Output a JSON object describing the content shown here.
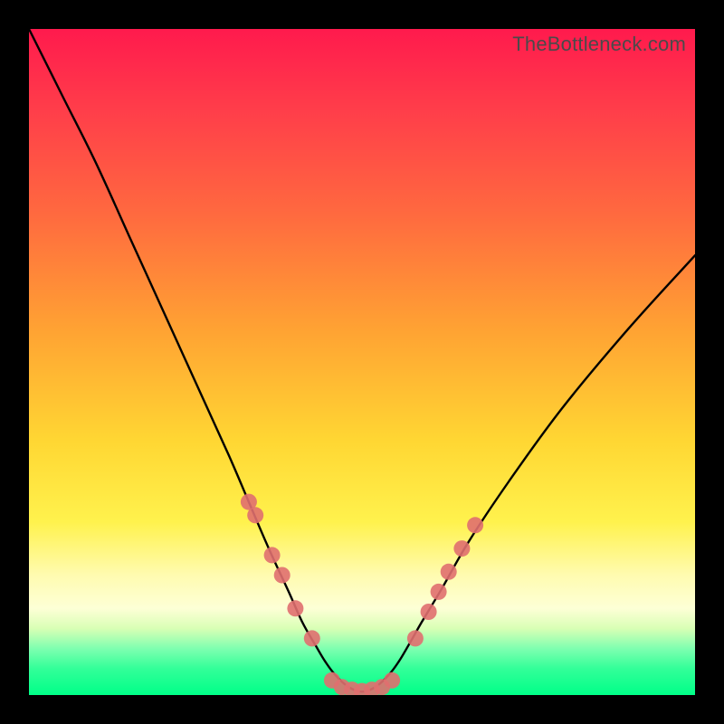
{
  "watermark": "TheBottleneck.com",
  "colors": {
    "frame": "#000000",
    "gradient_top": "#ff1a4d",
    "gradient_mid": "#ffd733",
    "gradient_bottom": "#00ff88",
    "curve": "#000000",
    "dots": "#e06f6f"
  },
  "chart_data": {
    "type": "line",
    "title": "",
    "xlabel": "",
    "ylabel": "",
    "xlim": [
      0,
      100
    ],
    "ylim": [
      0,
      100
    ],
    "grid": false,
    "series": [
      {
        "name": "bottleneck-curve",
        "x": [
          0,
          5,
          10,
          15,
          20,
          25,
          30,
          33,
          36,
          39,
          41,
          43,
          44.5,
          46,
          48,
          50,
          52,
          54,
          55.5,
          57,
          59,
          62,
          66,
          72,
          80,
          90,
          100
        ],
        "y": [
          100,
          90,
          80,
          69,
          58,
          47,
          36,
          29,
          22,
          15.5,
          11,
          7.5,
          5,
          3,
          1.2,
          0.5,
          1.2,
          3,
          5,
          7.5,
          11,
          16,
          23,
          32,
          43,
          55,
          66
        ]
      }
    ],
    "markers": [
      {
        "side": "left",
        "x": 33,
        "y": 29
      },
      {
        "side": "left",
        "x": 34,
        "y": 27
      },
      {
        "side": "left",
        "x": 36.5,
        "y": 21
      },
      {
        "side": "left",
        "x": 38,
        "y": 18
      },
      {
        "side": "left",
        "x": 40,
        "y": 13
      },
      {
        "side": "left",
        "x": 42.5,
        "y": 8.5
      },
      {
        "side": "flat",
        "x": 45.5,
        "y": 2.2
      },
      {
        "side": "flat",
        "x": 47,
        "y": 1.2
      },
      {
        "side": "flat",
        "x": 48.5,
        "y": 0.8
      },
      {
        "side": "flat",
        "x": 50,
        "y": 0.6
      },
      {
        "side": "flat",
        "x": 51.5,
        "y": 0.8
      },
      {
        "side": "flat",
        "x": 53,
        "y": 1.2
      },
      {
        "side": "flat",
        "x": 54.5,
        "y": 2.2
      },
      {
        "side": "right",
        "x": 58,
        "y": 8.5
      },
      {
        "side": "right",
        "x": 60,
        "y": 12.5
      },
      {
        "side": "right",
        "x": 61.5,
        "y": 15.5
      },
      {
        "side": "right",
        "x": 63,
        "y": 18.5
      },
      {
        "side": "right",
        "x": 65,
        "y": 22
      },
      {
        "side": "right",
        "x": 67,
        "y": 25.5
      }
    ]
  }
}
